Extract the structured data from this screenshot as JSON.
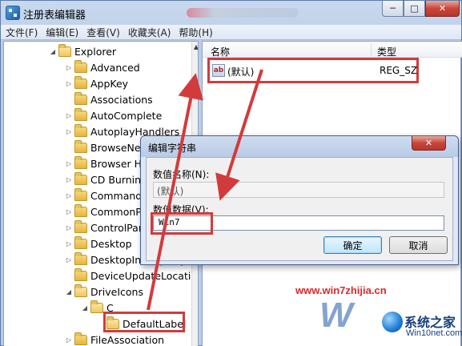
{
  "window": {
    "title": "注册表编辑器",
    "controls": {
      "minimize": "─",
      "maximize": "□",
      "close": "✕"
    }
  },
  "menu": {
    "items": [
      "文件(F)",
      "编辑(E)",
      "查看(V)",
      "收藏夹(A)",
      "帮助(H)"
    ]
  },
  "tree": {
    "items": [
      {
        "label": "Explorer",
        "expander": "◢",
        "level": 0,
        "open": true
      },
      {
        "label": "Advanced",
        "expander": "▷",
        "level": 1
      },
      {
        "label": "AppKey",
        "expander": "▷",
        "level": 1
      },
      {
        "label": "Associations",
        "expander": "",
        "level": 1
      },
      {
        "label": "AutoComplete",
        "expander": "▷",
        "level": 1
      },
      {
        "label": "AutoplayHandlers",
        "expander": "▷",
        "level": 1
      },
      {
        "label": "BrowseNewProcess",
        "expander": "",
        "level": 1
      },
      {
        "label": "Browser Helper Objects",
        "expander": "▷",
        "level": 1
      },
      {
        "label": "CD Burning",
        "expander": "▷",
        "level": 1
      },
      {
        "label": "CommandStore",
        "expander": "▷",
        "level": 1
      },
      {
        "label": "CommonPlaces",
        "expander": "▷",
        "level": 1
      },
      {
        "label": "ControlPanel",
        "expander": "▷",
        "level": 1
      },
      {
        "label": "Desktop",
        "expander": "▷",
        "level": 1
      },
      {
        "label": "DesktopIniPropertyMap",
        "expander": "▷",
        "level": 1
      },
      {
        "label": "DeviceUpdateLocations",
        "expander": "",
        "level": 1
      },
      {
        "label": "DriveIcons",
        "expander": "◢",
        "level": 1,
        "open": true
      },
      {
        "label": "C",
        "expander": "◢",
        "level": 2,
        "open": true
      },
      {
        "label": "DefaultLabel",
        "expander": "",
        "level": 3,
        "open": true
      },
      {
        "label": "FileAssociation",
        "expander": "▷",
        "level": 1
      }
    ]
  },
  "values_pane": {
    "col_name": "名称",
    "col_type": "类型",
    "rows": [
      {
        "icon": "ab",
        "name": "(默认)",
        "type": "REG_SZ"
      }
    ]
  },
  "dialog": {
    "title": "编辑字符串",
    "close": "✕",
    "name_label": "数值名称(N):",
    "name_value": "(默认)",
    "data_label": "数值数据(V):",
    "data_value": "Win7",
    "ok": "确定",
    "cancel": "取消"
  },
  "watermark": {
    "url": "www.win7zhijia.cn",
    "logo": "W",
    "site": "系统之家",
    "domain": "Win10net.com"
  },
  "colors": {
    "highlight_red": "#d23b3b",
    "accent_blue": "#1f5aa8"
  }
}
